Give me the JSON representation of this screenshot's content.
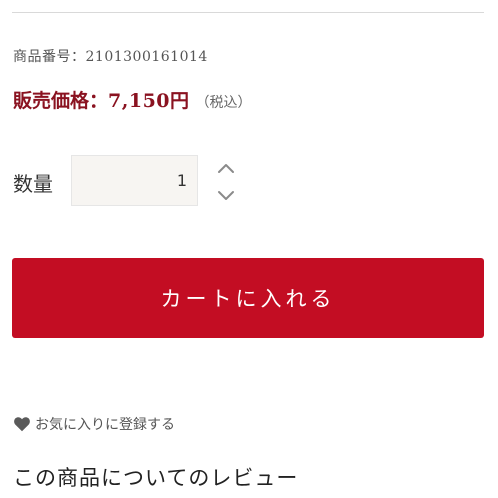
{
  "product": {
    "number_label": "商品番号：",
    "number_value": "2101300161014",
    "price_label": "販売価格：",
    "price_value": "7,150円",
    "price_tax_note": "（税込）"
  },
  "quantity": {
    "label": "数量",
    "value": "1"
  },
  "stepper": {
    "up_icon": "chevron-up-icon",
    "down_icon": "chevron-down-icon"
  },
  "cart": {
    "button_label": "カートに入れる"
  },
  "favorite": {
    "icon": "heart-icon",
    "label": "お気に入りに登録する"
  },
  "reviews": {
    "title": "この商品についてのレビュー"
  },
  "colors": {
    "accent": "#c30d23",
    "price_text": "#8a1220",
    "input_bg": "#f7f5f2"
  }
}
